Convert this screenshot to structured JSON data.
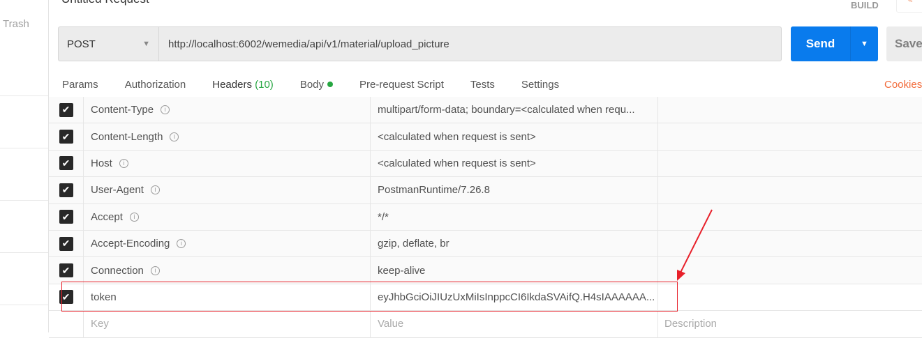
{
  "sidebar": {
    "trash": "Trash"
  },
  "header": {
    "title": "Untitled Request",
    "build": "BUILD"
  },
  "request": {
    "method": "POST",
    "url": "http://localhost:6002/wemedia/api/v1/material/upload_picture",
    "send": "Send",
    "save": "Save"
  },
  "tabs": [
    {
      "label": "Params"
    },
    {
      "label": "Authorization"
    },
    {
      "label": "Headers",
      "count": "(10)"
    },
    {
      "label": "Body"
    },
    {
      "label": "Pre-request Script"
    },
    {
      "label": "Tests"
    },
    {
      "label": "Settings"
    }
  ],
  "cookies": "Cookies",
  "headers": [
    {
      "key": "Content-Type",
      "value": "multipart/form-data; boundary=<calculated when requ..."
    },
    {
      "key": "Content-Length",
      "value": "<calculated when request is sent>"
    },
    {
      "key": "Host",
      "value": "<calculated when request is sent>"
    },
    {
      "key": "User-Agent",
      "value": "PostmanRuntime/7.26.8"
    },
    {
      "key": "Accept",
      "value": "*/*"
    },
    {
      "key": "Accept-Encoding",
      "value": "gzip, deflate, br"
    },
    {
      "key": "Connection",
      "value": "keep-alive"
    },
    {
      "key": "token",
      "value": "eyJhbGciOiJIUzUxMiIsInppcCI6IkdaSVAifQ.H4sIAAAAAA..."
    }
  ],
  "placeholders": {
    "key": "Key",
    "value": "Value",
    "description": "Description"
  },
  "colors": {
    "accent": "#f26b3a",
    "send": "#097bed",
    "annotation": "#e8202a"
  }
}
